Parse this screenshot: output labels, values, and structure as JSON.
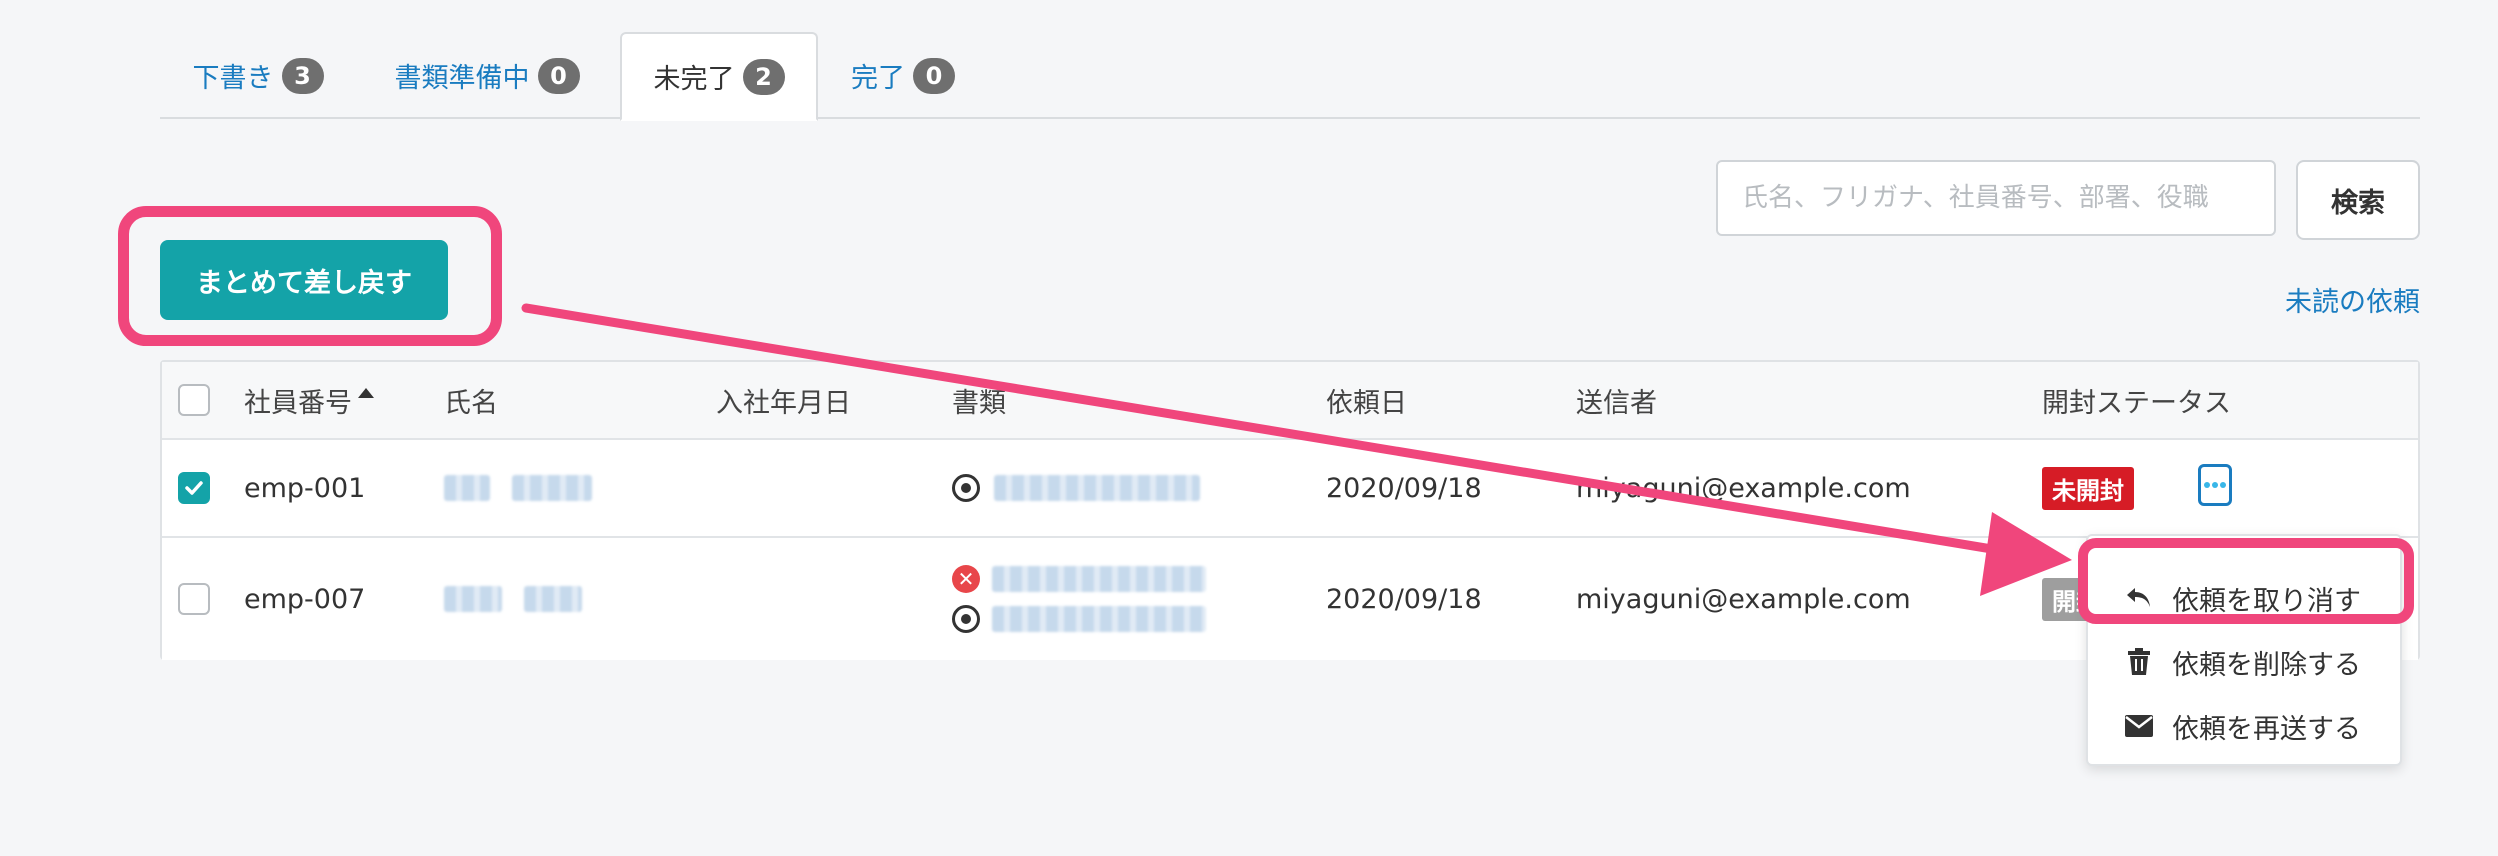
{
  "tabs": [
    {
      "label": "下書き",
      "count": "3"
    },
    {
      "label": "書類準備中",
      "count": "0"
    },
    {
      "label": "未完了",
      "count": "2"
    },
    {
      "label": "完了",
      "count": "0"
    }
  ],
  "search": {
    "placeholder": "氏名、フリガナ、社員番号、部署、役職",
    "button_label": "検索"
  },
  "unread_link": "未読の依頼",
  "bulk_return_label": "まとめて差し戻す",
  "table": {
    "columns": [
      "社員番号",
      "氏名",
      "入社年月日",
      "書類",
      "依頼日",
      "送信者",
      "開封ステータス"
    ],
    "rows": [
      {
        "checked": true,
        "employee_id": "emp-001",
        "request_date": "2020/09/18",
        "sender": "miyaguni@example.com",
        "status": "未開封"
      },
      {
        "checked": false,
        "employee_id": "emp-007",
        "request_date": "2020/09/18",
        "sender": "miyaguni@example.com",
        "status": "開封"
      }
    ]
  },
  "menu": {
    "items": [
      {
        "label": "依頼を取り消す",
        "icon": "undo-icon"
      },
      {
        "label": "依頼を削除する",
        "icon": "trash-icon"
      },
      {
        "label": "依頼を再送する",
        "icon": "envelope-icon"
      }
    ]
  },
  "colors": {
    "accent": "#14a3a8",
    "link": "#1a7cc0",
    "highlight": "#f0467c",
    "status_unopened": "#d61c26"
  }
}
